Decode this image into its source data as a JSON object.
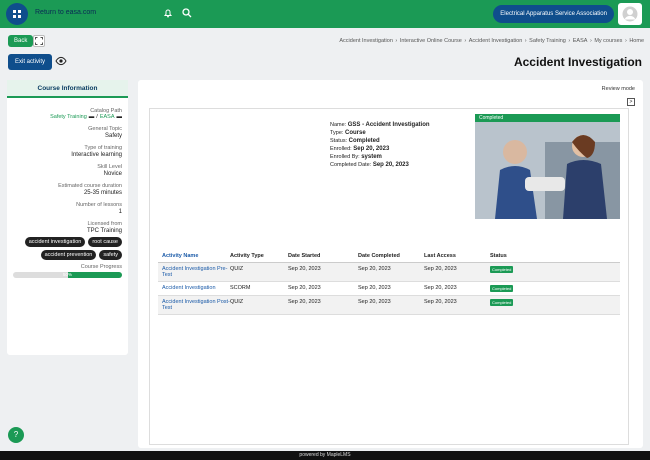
{
  "topbar": {
    "org_button_label": "Electrical Apparatus Service Association",
    "return_link": "Return to easa.com",
    "search_icon": "search-icon",
    "bell_icon": "bell-icon"
  },
  "toolbar": {
    "back_label": "Back",
    "exit_label": "Exit activity"
  },
  "breadcrumb": [
    "Home",
    "My courses",
    "EASA",
    "Safety Training",
    "Accident Investigation",
    "Interactive Online Course",
    "Accident Investigation"
  ],
  "page_title": "Accident Investigation",
  "sidebar": {
    "header": "Course Information",
    "catalog_path_label": "Catalog Path",
    "catalog_path": [
      "EASA",
      "Safety Training"
    ],
    "general_topic_label": "General Topic",
    "general_topic": "Safety",
    "type_label": "Type of training",
    "type": "Interactive learning",
    "skill_label": "Skill Level",
    "skill": "Novice",
    "duration_label": "Estimated course duration",
    "duration": "25-35 minutes",
    "lessons_label": "Number of lessons",
    "lessons": "1",
    "licensed_label": "Licensed from",
    "licensed": "TPC Training",
    "tags": [
      "accident investigation",
      "accident prevention",
      "root cause",
      "safety"
    ],
    "progress_label": "Course Progress",
    "progress_text": "50%",
    "progress_value": 0.5
  },
  "main": {
    "review_mode": "Review mode",
    "arrow": ">",
    "completed_strip": "Completed",
    "info": {
      "name_label": "Name:",
      "name": "GSS - Accident Investigation",
      "type_label": "Type:",
      "type": "Course",
      "status_label": "Status:",
      "status": "Completed",
      "enrolled_label": "Enrolled:",
      "enrolled": "Sep 20, 2023",
      "enrolled_by_label": "Enrolled By:",
      "enrolled_by": "system",
      "completed_label": "Completed Date:",
      "completed": "Sep 20, 2023"
    },
    "table": {
      "headers": [
        "Activity Name",
        "Activity Type",
        "Date Started",
        "Date Completed",
        "Last Access",
        "Status"
      ],
      "rows": [
        {
          "name": "Accident Investigation Pre-Test",
          "type": "QUIZ",
          "started": "Sep 20, 2023",
          "completed": "Sep 20, 2023",
          "last": "Sep 20, 2023",
          "status": "Completed"
        },
        {
          "name": "Accident Investigation",
          "type": "SCORM",
          "started": "Sep 20, 2023",
          "completed": "Sep 20, 2023",
          "last": "Sep 20, 2023",
          "status": "Completed"
        },
        {
          "name": "Accident Investigation Post-Test",
          "type": "QUIZ",
          "started": "Sep 20, 2023",
          "completed": "Sep 20, 2023",
          "last": "Sep 20, 2023",
          "status": "Completed"
        }
      ]
    }
  },
  "help_label": "?",
  "footer": "powered by MapleLMS",
  "colors": {
    "brand_green": "#1b9a55",
    "brand_blue": "#0f4e8c"
  }
}
